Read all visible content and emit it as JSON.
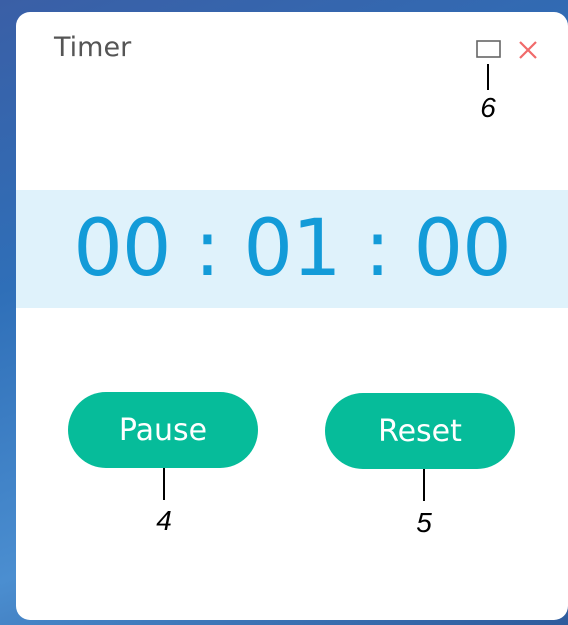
{
  "window": {
    "title": "Timer"
  },
  "controls": {
    "restore_icon": "window-restore-icon",
    "close_icon": "close-icon",
    "close_color": "#f06a6a"
  },
  "timer": {
    "display": "00 : 01 : 00",
    "color": "#139bd8",
    "band_color": "#dff2fb"
  },
  "buttons": {
    "pause_label": "Pause",
    "reset_label": "Reset",
    "color": "#06bc9a"
  },
  "callouts": {
    "pause": "4",
    "reset": "5",
    "restore": "6"
  }
}
